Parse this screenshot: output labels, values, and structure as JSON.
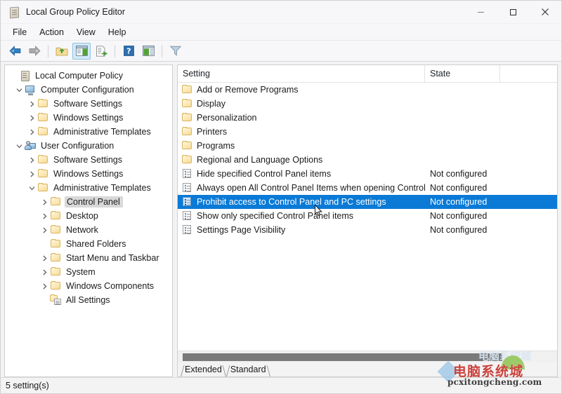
{
  "window": {
    "title": "Local Group Policy Editor",
    "icon": "console-document-icon",
    "buttons": {
      "minimize": "Minimize",
      "maximize": "Maximize",
      "close": "Close"
    }
  },
  "menubar": {
    "items": [
      {
        "label": "File",
        "name": "menu-file"
      },
      {
        "label": "Action",
        "name": "menu-action"
      },
      {
        "label": "View",
        "name": "menu-view"
      },
      {
        "label": "Help",
        "name": "menu-help"
      }
    ]
  },
  "toolbar": {
    "items": [
      {
        "name": "back-icon",
        "title": "Back"
      },
      {
        "name": "forward-icon",
        "title": "Forward"
      },
      {
        "name": "up-one-level-icon",
        "title": "Up One Level"
      },
      {
        "name": "show-hide-console-tree-icon",
        "title": "Show/Hide Console Tree"
      },
      {
        "name": "export-list-icon",
        "title": "Export List"
      },
      {
        "name": "help-icon",
        "title": "Help"
      },
      {
        "name": "show-action-pane-icon",
        "title": "Show/Hide Action Pane"
      },
      {
        "name": "filter-icon",
        "title": "Filter Options"
      }
    ]
  },
  "tree": {
    "nodes": [
      {
        "label": "Local Computer Policy",
        "indent": 0,
        "chevron": "none",
        "icon": "policy-document-icon",
        "selected": false
      },
      {
        "label": "Computer Configuration",
        "indent": 1,
        "chevron": "expanded",
        "icon": "computer-icon",
        "selected": false
      },
      {
        "label": "Software Settings",
        "indent": 2,
        "chevron": "collapsed",
        "icon": "folder-icon",
        "selected": false
      },
      {
        "label": "Windows Settings",
        "indent": 2,
        "chevron": "collapsed",
        "icon": "folder-icon",
        "selected": false
      },
      {
        "label": "Administrative Templates",
        "indent": 2,
        "chevron": "collapsed",
        "icon": "folder-icon",
        "selected": false
      },
      {
        "label": "User Configuration",
        "indent": 1,
        "chevron": "expanded",
        "icon": "user-icon",
        "selected": false
      },
      {
        "label": "Software Settings",
        "indent": 2,
        "chevron": "collapsed",
        "icon": "folder-icon",
        "selected": false
      },
      {
        "label": "Windows Settings",
        "indent": 2,
        "chevron": "collapsed",
        "icon": "folder-icon",
        "selected": false
      },
      {
        "label": "Administrative Templates",
        "indent": 2,
        "chevron": "expanded",
        "icon": "folder-icon",
        "selected": false
      },
      {
        "label": "Control Panel",
        "indent": 3,
        "chevron": "collapsed",
        "icon": "folder-icon",
        "selected": true
      },
      {
        "label": "Desktop",
        "indent": 3,
        "chevron": "collapsed",
        "icon": "folder-icon",
        "selected": false
      },
      {
        "label": "Network",
        "indent": 3,
        "chevron": "collapsed",
        "icon": "folder-icon",
        "selected": false
      },
      {
        "label": "Shared Folders",
        "indent": 3,
        "chevron": "none",
        "icon": "folder-icon",
        "selected": false
      },
      {
        "label": "Start Menu and Taskbar",
        "indent": 3,
        "chevron": "collapsed",
        "icon": "folder-icon",
        "selected": false
      },
      {
        "label": "System",
        "indent": 3,
        "chevron": "collapsed",
        "icon": "folder-icon",
        "selected": false
      },
      {
        "label": "Windows Components",
        "indent": 3,
        "chevron": "collapsed",
        "icon": "folder-icon",
        "selected": false
      },
      {
        "label": "All Settings",
        "indent": 3,
        "chevron": "none",
        "icon": "all-settings-icon",
        "selected": false
      }
    ]
  },
  "list": {
    "columns": [
      {
        "label": "Setting",
        "name": "column-header-setting"
      },
      {
        "label": "State",
        "name": "column-header-state"
      },
      {
        "label": "",
        "name": "column-header-blank"
      }
    ],
    "rows": [
      {
        "setting": "Add or Remove Programs",
        "state": "",
        "icon": "folder-icon",
        "selected": false
      },
      {
        "setting": "Display",
        "state": "",
        "icon": "folder-icon",
        "selected": false
      },
      {
        "setting": "Personalization",
        "state": "",
        "icon": "folder-icon",
        "selected": false
      },
      {
        "setting": "Printers",
        "state": "",
        "icon": "folder-icon",
        "selected": false
      },
      {
        "setting": "Programs",
        "state": "",
        "icon": "folder-icon",
        "selected": false
      },
      {
        "setting": "Regional and Language Options",
        "state": "",
        "icon": "folder-icon",
        "selected": false
      },
      {
        "setting": "Hide specified Control Panel items",
        "state": "Not configured",
        "icon": "policy-setting-icon",
        "selected": false
      },
      {
        "setting": "Always open All Control Panel Items when opening Control P...",
        "state": "Not configured",
        "icon": "policy-setting-icon",
        "selected": false
      },
      {
        "setting": "Prohibit access to Control Panel and PC settings",
        "state": "Not configured",
        "icon": "policy-setting-icon",
        "selected": true
      },
      {
        "setting": "Show only specified Control Panel items",
        "state": "Not configured",
        "icon": "policy-setting-icon",
        "selected": false
      },
      {
        "setting": "Settings Page Visibility",
        "state": "Not configured",
        "icon": "policy-setting-icon",
        "selected": false
      }
    ]
  },
  "tabs": [
    {
      "label": "Extended",
      "name": "tab-extended",
      "active": false
    },
    {
      "label": "Standard",
      "name": "tab-standard",
      "active": true
    }
  ],
  "statusbar": {
    "text": "5 setting(s)"
  },
  "watermark": {
    "chinese": "电脑系统城",
    "domain": "pcxitongcheng.com",
    "ghost": "电脑系统城"
  },
  "colors": {
    "selection_blue": "#0a7ad6",
    "tree_selection_gray": "#d8d8d8",
    "window_bg": "#f3f3f3",
    "pane_bg": "#ffffff",
    "watermark_red": "#c9332e"
  }
}
